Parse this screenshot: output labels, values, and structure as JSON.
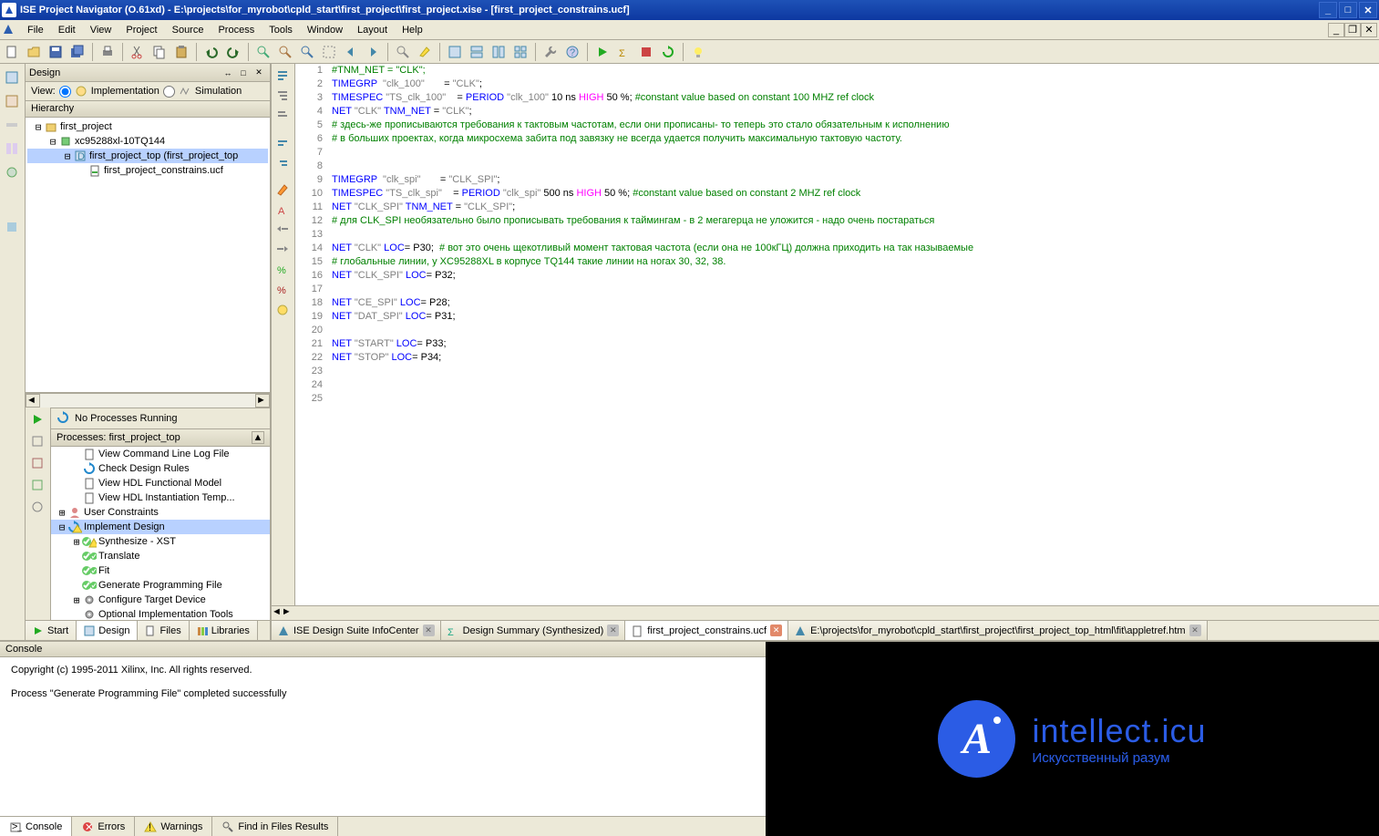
{
  "titlebar": {
    "title": "ISE Project Navigator (O.61xd) - E:\\projects\\for_myrobot\\cpld_start\\first_project\\first_project.xise - [first_project_constrains.ucf]"
  },
  "menu": {
    "items": [
      "File",
      "Edit",
      "View",
      "Project",
      "Source",
      "Process",
      "Tools",
      "Window",
      "Layout",
      "Help"
    ]
  },
  "design_panel": {
    "title": "Design",
    "view_label": "View:",
    "impl_label": "Implementation",
    "sim_label": "Simulation",
    "hierarchy_label": "Hierarchy",
    "tree": [
      {
        "level": 0,
        "exp": "⊟",
        "icon": "project",
        "label": "first_project"
      },
      {
        "level": 1,
        "exp": "⊟",
        "icon": "chip",
        "label": "xc95288xl-10TQ144"
      },
      {
        "level": 2,
        "exp": "⊟",
        "icon": "module",
        "label": "first_project_top (first_project_top",
        "selected": true
      },
      {
        "level": 3,
        "exp": "",
        "icon": "ucf",
        "label": "first_project_constrains.ucf"
      }
    ],
    "no_processes": "No Processes Running",
    "processes_label": "Processes: first_project_top",
    "processes": [
      {
        "level": 1,
        "exp": "",
        "icon": "doc",
        "label": "View Command Line Log File"
      },
      {
        "level": 1,
        "exp": "",
        "icon": "refresh",
        "label": "Check Design Rules"
      },
      {
        "level": 1,
        "exp": "",
        "icon": "doc",
        "label": "View HDL Functional Model"
      },
      {
        "level": 1,
        "exp": "",
        "icon": "doc",
        "label": "View HDL Instantiation Temp..."
      },
      {
        "level": 0,
        "exp": "⊞",
        "icon": "user",
        "label": "User Constraints"
      },
      {
        "level": 0,
        "exp": "⊟",
        "icon": "impl-warn",
        "label": "Implement Design",
        "selected": true
      },
      {
        "level": 1,
        "exp": "⊞",
        "icon": "ok-warn",
        "label": "Synthesize - XST"
      },
      {
        "level": 1,
        "exp": "",
        "icon": "ok-ok",
        "label": "Translate"
      },
      {
        "level": 1,
        "exp": "",
        "icon": "ok-ok",
        "label": "Fit"
      },
      {
        "level": 1,
        "exp": "",
        "icon": "ok-ok",
        "label": "Generate Programming File"
      },
      {
        "level": 1,
        "exp": "⊞",
        "icon": "gear",
        "label": "Configure Target Device"
      },
      {
        "level": 1,
        "exp": "",
        "icon": "gear",
        "label": "Optional Implementation Tools"
      }
    ]
  },
  "bottom_tabs": {
    "start": "Start",
    "design": "Design",
    "files": "Files",
    "libraries": "Libraries"
  },
  "editor": {
    "lines": [
      {
        "n": 1,
        "segments": [
          {
            "c": "cm",
            "t": "#TNM_NET = \"CLK\";"
          }
        ]
      },
      {
        "n": 2,
        "segments": [
          {
            "c": "kw",
            "t": "TIMEGRP"
          },
          {
            "c": "",
            "t": "  "
          },
          {
            "c": "str",
            "t": "\"clk_100\""
          },
          {
            "c": "",
            "t": "       = "
          },
          {
            "c": "str",
            "t": "\"CLK\""
          },
          {
            "c": "",
            "t": ";"
          }
        ]
      },
      {
        "n": 3,
        "segments": [
          {
            "c": "kw",
            "t": "TIMESPEC"
          },
          {
            "c": "",
            "t": " "
          },
          {
            "c": "str",
            "t": "\"TS_clk_100\""
          },
          {
            "c": "",
            "t": "    = "
          },
          {
            "c": "kw",
            "t": "PERIOD"
          },
          {
            "c": "",
            "t": " "
          },
          {
            "c": "str",
            "t": "\"clk_100\""
          },
          {
            "c": "",
            "t": " 10 ns "
          },
          {
            "c": "hl",
            "t": "HIGH"
          },
          {
            "c": "",
            "t": " 50 %; "
          },
          {
            "c": "cm",
            "t": "#constant value based on constant 100 MHZ ref clock"
          }
        ]
      },
      {
        "n": 4,
        "segments": [
          {
            "c": "kw",
            "t": "NET"
          },
          {
            "c": "",
            "t": " "
          },
          {
            "c": "str",
            "t": "\"CLK\""
          },
          {
            "c": "",
            "t": " "
          },
          {
            "c": "kw",
            "t": "TNM_NET"
          },
          {
            "c": "",
            "t": " = "
          },
          {
            "c": "str",
            "t": "\"CLK\""
          },
          {
            "c": "",
            "t": ";"
          }
        ]
      },
      {
        "n": 5,
        "segments": [
          {
            "c": "cm",
            "t": "# здесь-же прописываются требования к тактовым частотам, если они прописаны- то теперь это стало обязательным к исполнению"
          }
        ]
      },
      {
        "n": 6,
        "segments": [
          {
            "c": "cm",
            "t": "# в больших проектах, когда микросхема забита под завязку не всегда удается получить максимальную тактовую частоту."
          }
        ]
      },
      {
        "n": 7,
        "segments": []
      },
      {
        "n": 8,
        "segments": []
      },
      {
        "n": 9,
        "segments": [
          {
            "c": "kw",
            "t": "TIMEGRP"
          },
          {
            "c": "",
            "t": "  "
          },
          {
            "c": "str",
            "t": "\"clk_spi\""
          },
          {
            "c": "",
            "t": "       = "
          },
          {
            "c": "str",
            "t": "\"CLK_SPI\""
          },
          {
            "c": "",
            "t": ";"
          }
        ]
      },
      {
        "n": 10,
        "segments": [
          {
            "c": "kw",
            "t": "TIMESPEC"
          },
          {
            "c": "",
            "t": " "
          },
          {
            "c": "str",
            "t": "\"TS_clk_spi\""
          },
          {
            "c": "",
            "t": "    = "
          },
          {
            "c": "kw",
            "t": "PERIOD"
          },
          {
            "c": "",
            "t": " "
          },
          {
            "c": "str",
            "t": "\"clk_spi\""
          },
          {
            "c": "",
            "t": " 500 ns "
          },
          {
            "c": "hl",
            "t": "HIGH"
          },
          {
            "c": "",
            "t": " 50 %; "
          },
          {
            "c": "cm",
            "t": "#constant value based on constant 2 MHZ ref clock"
          }
        ]
      },
      {
        "n": 11,
        "segments": [
          {
            "c": "kw",
            "t": "NET"
          },
          {
            "c": "",
            "t": " "
          },
          {
            "c": "str",
            "t": "\"CLK_SPI\""
          },
          {
            "c": "",
            "t": " "
          },
          {
            "c": "kw",
            "t": "TNM_NET"
          },
          {
            "c": "",
            "t": " = "
          },
          {
            "c": "str",
            "t": "\"CLK_SPI\""
          },
          {
            "c": "",
            "t": ";"
          }
        ]
      },
      {
        "n": 12,
        "segments": [
          {
            "c": "cm",
            "t": "# для CLK_SPI необязательно было прописывать требования к таймингам - в 2 мегагерца не уложится - надо очень постараться"
          }
        ]
      },
      {
        "n": 13,
        "segments": []
      },
      {
        "n": 14,
        "segments": [
          {
            "c": "kw",
            "t": "NET"
          },
          {
            "c": "",
            "t": " "
          },
          {
            "c": "str",
            "t": "\"CLK\""
          },
          {
            "c": "",
            "t": " "
          },
          {
            "c": "kw",
            "t": "LOC"
          },
          {
            "c": "",
            "t": "= P30;  "
          },
          {
            "c": "cm",
            "t": "# вот это очень щекотливый момент тактовая частота (если она не 100кГЦ) должна приходить на так называемые"
          }
        ]
      },
      {
        "n": 15,
        "segments": [
          {
            "c": "cm",
            "t": "# глобальные линии, у XC95288XL в корпусе TQ144 такие линии на ногах 30, 32, 38."
          }
        ]
      },
      {
        "n": 16,
        "segments": [
          {
            "c": "kw",
            "t": "NET"
          },
          {
            "c": "",
            "t": " "
          },
          {
            "c": "str",
            "t": "\"CLK_SPI\""
          },
          {
            "c": "",
            "t": " "
          },
          {
            "c": "kw",
            "t": "LOC"
          },
          {
            "c": "",
            "t": "= P32;"
          }
        ]
      },
      {
        "n": 17,
        "segments": []
      },
      {
        "n": 18,
        "segments": [
          {
            "c": "kw",
            "t": "NET"
          },
          {
            "c": "",
            "t": " "
          },
          {
            "c": "str",
            "t": "\"CE_SPI\""
          },
          {
            "c": "",
            "t": " "
          },
          {
            "c": "kw",
            "t": "LOC"
          },
          {
            "c": "",
            "t": "= P28;"
          }
        ]
      },
      {
        "n": 19,
        "segments": [
          {
            "c": "kw",
            "t": "NET"
          },
          {
            "c": "",
            "t": " "
          },
          {
            "c": "str",
            "t": "\"DAT_SPI\""
          },
          {
            "c": "",
            "t": " "
          },
          {
            "c": "kw",
            "t": "LOC"
          },
          {
            "c": "",
            "t": "= P31;"
          }
        ]
      },
      {
        "n": 20,
        "segments": []
      },
      {
        "n": 21,
        "segments": [
          {
            "c": "kw",
            "t": "NET"
          },
          {
            "c": "",
            "t": " "
          },
          {
            "c": "str",
            "t": "\"START\""
          },
          {
            "c": "",
            "t": " "
          },
          {
            "c": "kw",
            "t": "LOC"
          },
          {
            "c": "",
            "t": "= P33;"
          }
        ]
      },
      {
        "n": 22,
        "segments": [
          {
            "c": "kw",
            "t": "NET"
          },
          {
            "c": "",
            "t": " "
          },
          {
            "c": "str",
            "t": "\"STOP\""
          },
          {
            "c": "",
            "t": " "
          },
          {
            "c": "kw",
            "t": "LOC"
          },
          {
            "c": "",
            "t": "= P34;"
          }
        ]
      },
      {
        "n": 23,
        "segments": []
      },
      {
        "n": 24,
        "segments": []
      },
      {
        "n": 25,
        "segments": []
      }
    ],
    "tabs": [
      {
        "icon": "info",
        "label": "ISE Design Suite InfoCenter",
        "close": "p"
      },
      {
        "icon": "sigma",
        "label": "Design Summary (Synthesized)",
        "close": "p"
      },
      {
        "icon": "doc",
        "label": "first_project_constrains.ucf",
        "close": "x",
        "active": true
      },
      {
        "icon": "html",
        "label": "E:\\projects\\for_myrobot\\cpld_start\\first_project\\first_project_top_html\\fit\\appletref.htm",
        "close": "p"
      }
    ]
  },
  "console": {
    "title": "Console",
    "body1": "Copyright (c) 1995-2011 Xilinx, Inc.  All rights reserved.",
    "body2": "Process \"Generate Programming File\" completed successfully",
    "tabs": [
      {
        "icon": "console",
        "label": "Console",
        "active": true
      },
      {
        "icon": "error",
        "label": "Errors"
      },
      {
        "icon": "warn",
        "label": "Warnings"
      },
      {
        "icon": "find",
        "label": "Find in Files Results"
      }
    ]
  },
  "logo": {
    "big": "intellect.icu",
    "small": "Искусственный разум"
  }
}
